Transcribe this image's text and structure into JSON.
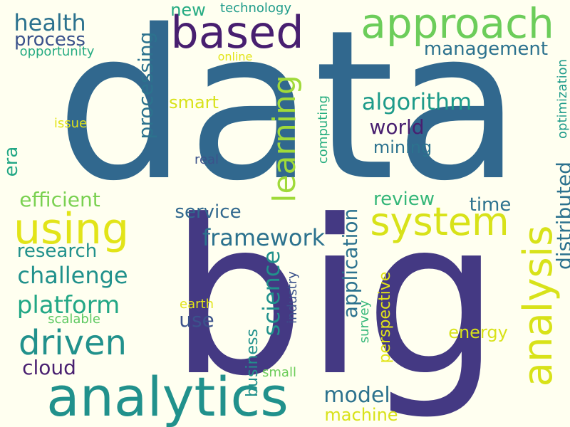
{
  "words": {
    "data": {
      "text": "data",
      "color": "#31688e"
    },
    "big": {
      "text": "big",
      "color": "#443983"
    },
    "analytics": {
      "text": "analytics",
      "color": "#21918c"
    },
    "based": {
      "text": "based",
      "color": "#481f70"
    },
    "approach": {
      "text": "approach",
      "color": "#6ccd5a"
    },
    "analysis": {
      "text": "analysis",
      "color": "#d8e219"
    },
    "system": {
      "text": "system",
      "color": "#d8e219"
    },
    "using": {
      "text": "using",
      "color": "#e2e418"
    },
    "learning": {
      "text": "learning",
      "color": "#a0da39"
    },
    "driven": {
      "text": "driven",
      "color": "#21918c"
    },
    "health": {
      "text": "health",
      "color": "#2c728e"
    },
    "process": {
      "text": "process",
      "color": "#3b528b"
    },
    "opportunity": {
      "text": "opportunity",
      "color": "#25ab82"
    },
    "new": {
      "text": "new",
      "color": "#25ab82"
    },
    "technology": {
      "text": "technology",
      "color": "#1e9b8a"
    },
    "online": {
      "text": "online",
      "color": "#e2e418"
    },
    "processing": {
      "text": "processing",
      "color": "#2c728e"
    },
    "smart": {
      "text": "smart",
      "color": "#d8e219"
    },
    "issue": {
      "text": "issue",
      "color": "#e2e418"
    },
    "era": {
      "text": "era",
      "color": "#22a785"
    },
    "real": {
      "text": "real",
      "color": "#3b528b"
    },
    "computing": {
      "text": "computing",
      "color": "#28ae80"
    },
    "management": {
      "text": "management",
      "color": "#2c728e"
    },
    "algorithm": {
      "text": "algorithm",
      "color": "#1e9b8a"
    },
    "world": {
      "text": "world",
      "color": "#481f70"
    },
    "mining": {
      "text": "mining",
      "color": "#2c728e"
    },
    "optimization": {
      "text": "optimization",
      "color": "#1e9b8a"
    },
    "distributed": {
      "text": "distributed",
      "color": "#2c728e"
    },
    "efficient": {
      "text": "efficient",
      "color": "#7ad151"
    },
    "service": {
      "text": "service",
      "color": "#31688e"
    },
    "framework": {
      "text": "framework",
      "color": "#2c728e"
    },
    "review": {
      "text": "review",
      "color": "#35b779"
    },
    "time": {
      "text": "time",
      "color": "#2c728e"
    },
    "application": {
      "text": "application",
      "color": "#2c728e"
    },
    "science": {
      "text": "science",
      "color": "#21918c"
    },
    "research": {
      "text": "research",
      "color": "#21918c"
    },
    "challenge": {
      "text": "challenge",
      "color": "#21918c"
    },
    "platform": {
      "text": "platform",
      "color": "#22a785"
    },
    "scalable": {
      "text": "scalable",
      "color": "#5ec962"
    },
    "earth": {
      "text": "earth",
      "color": "#e2e418"
    },
    "use": {
      "text": "use",
      "color": "#3b528b"
    },
    "industry": {
      "text": "industry",
      "color": "#3b528b"
    },
    "survey": {
      "text": "survey",
      "color": "#35b779"
    },
    "perspective": {
      "text": "perspective",
      "color": "#e2e418"
    },
    "energy": {
      "text": "energy",
      "color": "#d8e219"
    },
    "business": {
      "text": "business",
      "color": "#21918c"
    },
    "small": {
      "text": "small",
      "color": "#6ccd5a"
    },
    "cloud": {
      "text": "cloud",
      "color": "#481f70"
    },
    "model": {
      "text": "model",
      "color": "#2c728e"
    },
    "machine": {
      "text": "machine",
      "color": "#d8e219"
    }
  }
}
